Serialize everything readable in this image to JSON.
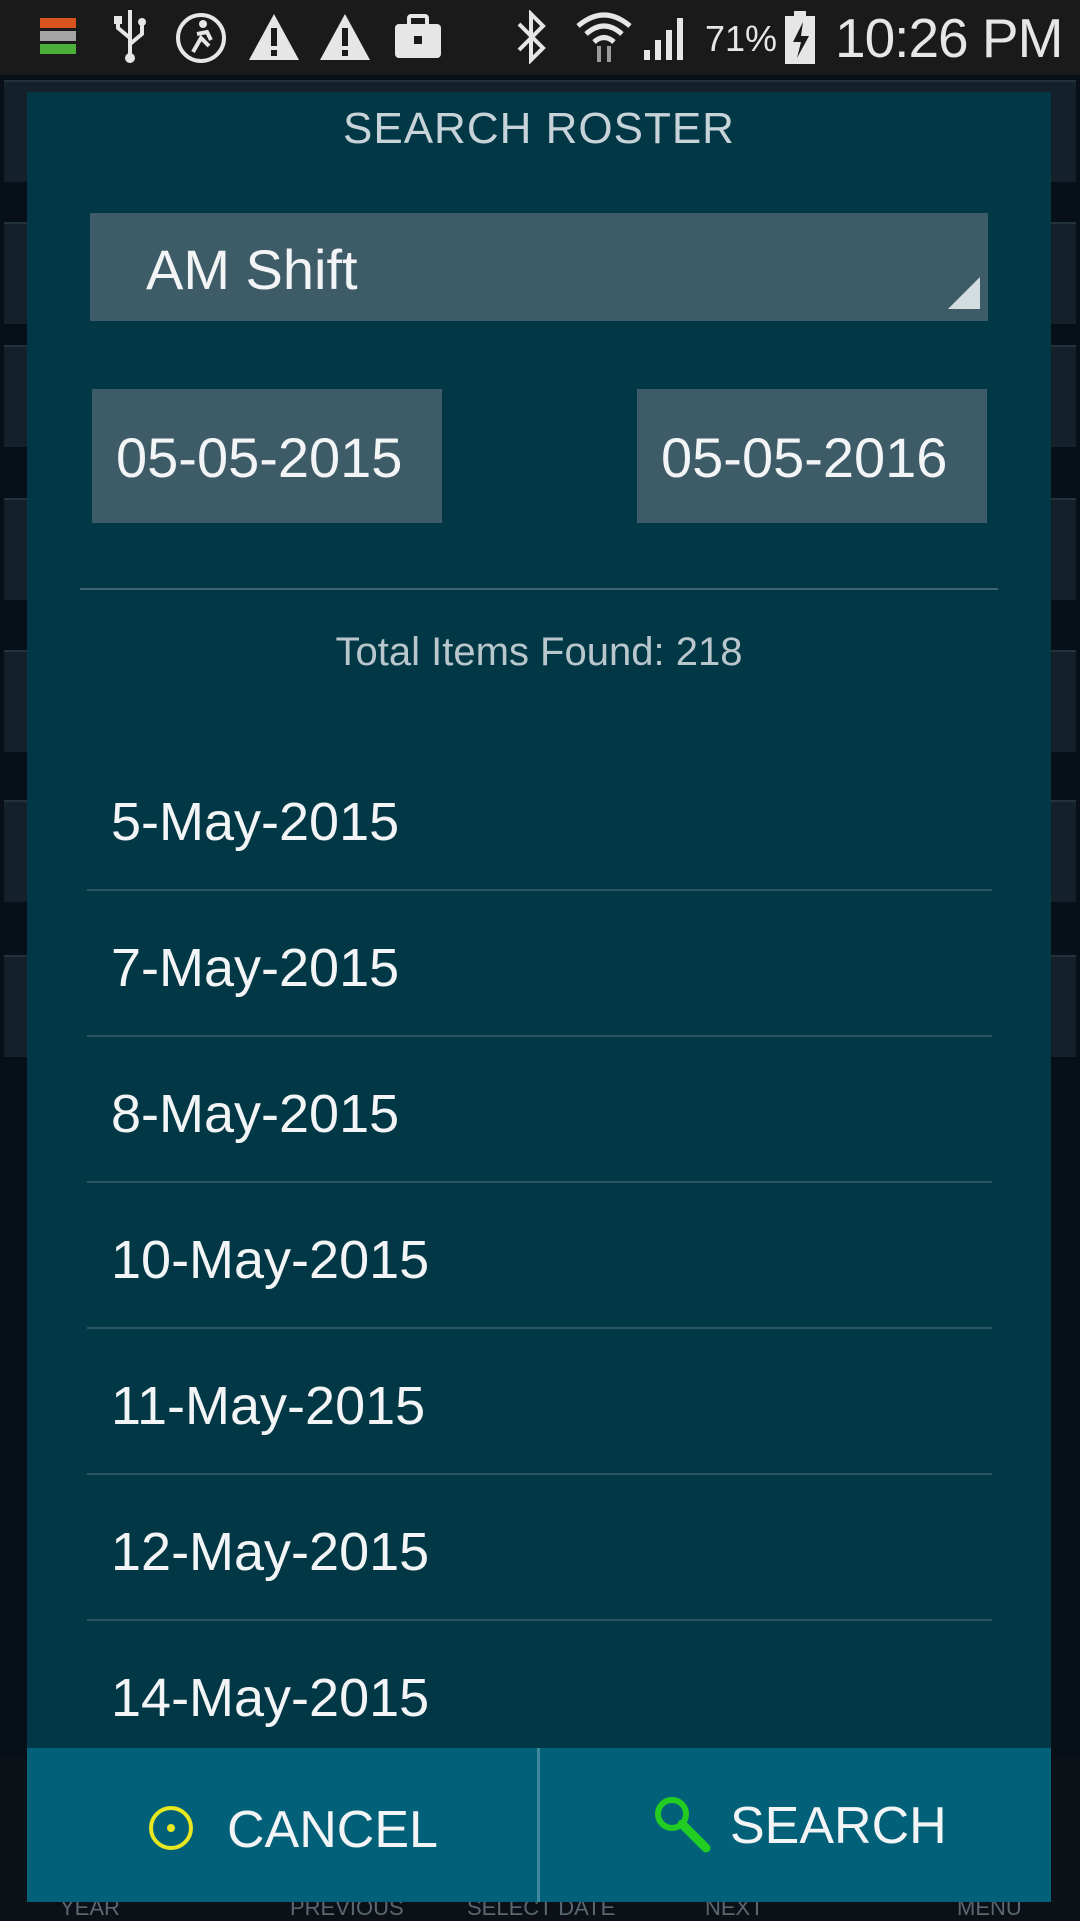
{
  "status_bar": {
    "battery_percent": "71%",
    "time": "10:26 PM",
    "icons": [
      "stack-app-icon",
      "usb-icon",
      "accessibility-icon",
      "warning-icon",
      "warning-icon",
      "briefcase-icon",
      "bluetooth-icon",
      "wifi-icon",
      "cell-signal-icon",
      "battery-charging-icon"
    ]
  },
  "dialog": {
    "title": "SEARCH ROSTER",
    "shift_select": {
      "selected": "AM Shift"
    },
    "start_date": "05-05-2015",
    "end_date": "05-05-2016",
    "total_found": "Total Items Found: 218",
    "results": [
      "5-May-2015",
      "7-May-2015",
      "8-May-2015",
      "10-May-2015",
      "11-May-2015",
      "12-May-2015",
      "14-May-2015"
    ],
    "cancel_label": "CANCEL",
    "search_label": "SEARCH"
  },
  "background_nav": {
    "year": "YEAR",
    "previous": "PREVIOUS",
    "select_date": "SELECT DATE",
    "next": "NEXT",
    "menu": "MENU"
  },
  "colors": {
    "dialog_bg": "#023846",
    "field_bg": "#3d5c67",
    "button_bar": "#026179",
    "cancel_icon": "#e8e820",
    "search_icon": "#22cc22"
  }
}
